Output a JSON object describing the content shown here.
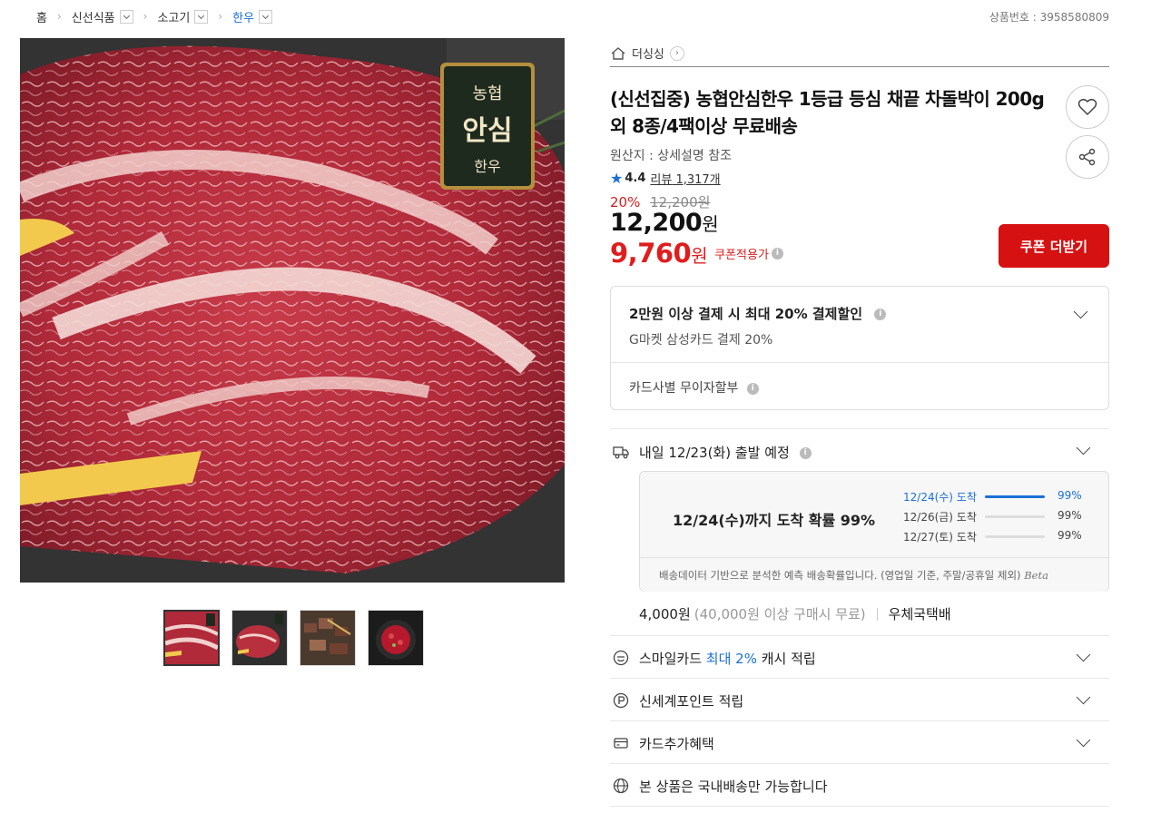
{
  "breadcrumb": [
    {
      "label": "홈",
      "dropdown": false
    },
    {
      "label": "신선식품",
      "dropdown": true
    },
    {
      "label": "소고기",
      "dropdown": true
    },
    {
      "label": "한우",
      "dropdown": true
    }
  ],
  "product_number": "상품번호 : 3958580809",
  "store_name": "더싱싱",
  "product": {
    "title": "(신선집중) 농협안심한우 1등급 등심 채끝 차돌박이 200g 외 8종/4팩이상 무료배송",
    "origin": "원산지 : 상세설명 참조",
    "rating": "4.4",
    "review_label": "리뷰",
    "review_count": "1,317개",
    "discount_pct": "20%",
    "original_price": "12,200원",
    "price_num": "12,200",
    "price_unit": "원",
    "coupon_price_num": "9,760",
    "coupon_price_unit": "원",
    "coupon_label": "쿠폰적용가",
    "badge_text": {
      "top": "농협",
      "main": "안심",
      "bottom": "한우"
    }
  },
  "buttons": {
    "coupon": "쿠폰 더받기"
  },
  "payment": {
    "title": "2만원 이상 결제 시 최대 20% 결제할인",
    "sub": "G마켓 삼성카드 결제 20%",
    "installment": "카드사별 무이자할부"
  },
  "delivery": {
    "title": "내일 12/23(화) 출발 예정",
    "headline": "12/24(수)까지 도착 확률 99%",
    "rows": [
      {
        "label": "12/24(수) 도착",
        "pct": "99%",
        "fill": 1.0
      },
      {
        "label": "12/26(금) 도착",
        "pct": "99%",
        "fill": 0.0
      },
      {
        "label": "12/27(토) 도착",
        "pct": "99%",
        "fill": 0.0
      }
    ],
    "note": "배송데이터 기반으로 분석한 예측 배송확률입니다. (영업일 기준, 주말/공휴일 제외)",
    "beta": "Beta",
    "fee": "4,000원",
    "fee_condition": "(40,000원 이상 구매시 무료)",
    "carrier": "우체국택배"
  },
  "benefits": {
    "smile_prefix": "스마일카드",
    "smile_highlight": "최대 2%",
    "smile_suffix": "캐시 적립",
    "shinsegae": "신세계포인트 적립",
    "card_extra": "카드추가혜택",
    "domestic": "본 상품은 국내배송만 가능합니다"
  },
  "colors": {
    "accent_red": "#d51111",
    "link_blue": "#1a6fd8"
  }
}
